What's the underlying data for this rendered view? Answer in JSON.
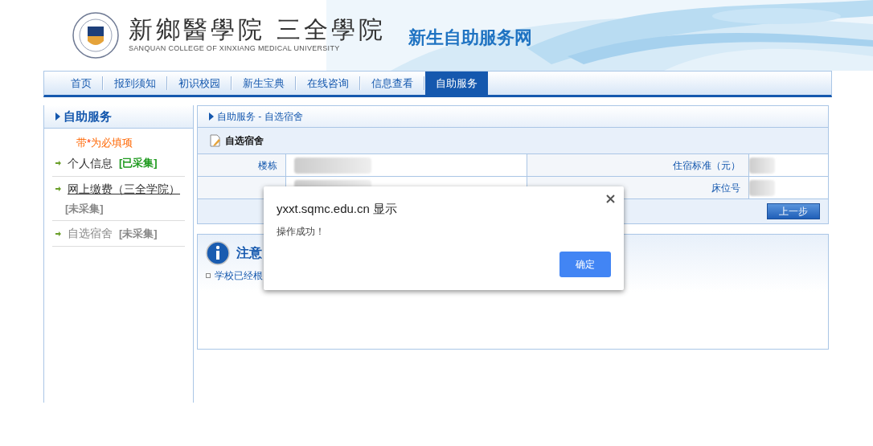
{
  "header": {
    "school_name": "新鄉醫學院 三全學院",
    "school_name_en": "SANQUAN COLLEGE OF XINXIANG MEDICAL UNIVERSITY",
    "site_title": "新生自助服务网"
  },
  "nav": [
    {
      "label": "首页",
      "selected": false
    },
    {
      "label": "报到须知",
      "selected": false
    },
    {
      "label": "初识校园",
      "selected": false
    },
    {
      "label": "新生宝典",
      "selected": false
    },
    {
      "label": "在线咨询",
      "selected": false
    },
    {
      "label": "信息查看",
      "selected": false
    },
    {
      "label": "自助服务",
      "selected": true
    }
  ],
  "sidebar": {
    "title": "自助服务",
    "note_before": "带",
    "note_mark": "*",
    "note_after": "为必填项",
    "items": [
      {
        "label": "个人信息",
        "status": "[已采集]",
        "collected": true,
        "hovered": false,
        "selected": false
      },
      {
        "label": "网上缴费（三全学院）",
        "status": "[未采集]",
        "collected": false,
        "hovered": true,
        "selected": false
      },
      {
        "label": "自选宿舍",
        "status": "[未采集]",
        "collected": false,
        "hovered": false,
        "selected": true
      }
    ]
  },
  "breadcrumb": "自助服务 - 自选宿舍",
  "form": {
    "title": "自选宿舍",
    "rows": [
      {
        "label_1": "楼栋",
        "label_2": "住宿标准（元）"
      },
      {
        "label_2": "床位号"
      }
    ],
    "button": "上一步"
  },
  "notice": {
    "title": "注意",
    "text": "学校已经根"
  },
  "dialog": {
    "title": "yxxt.sqmc.edu.cn 显示",
    "message": "操作成功！",
    "ok": "确定"
  }
}
